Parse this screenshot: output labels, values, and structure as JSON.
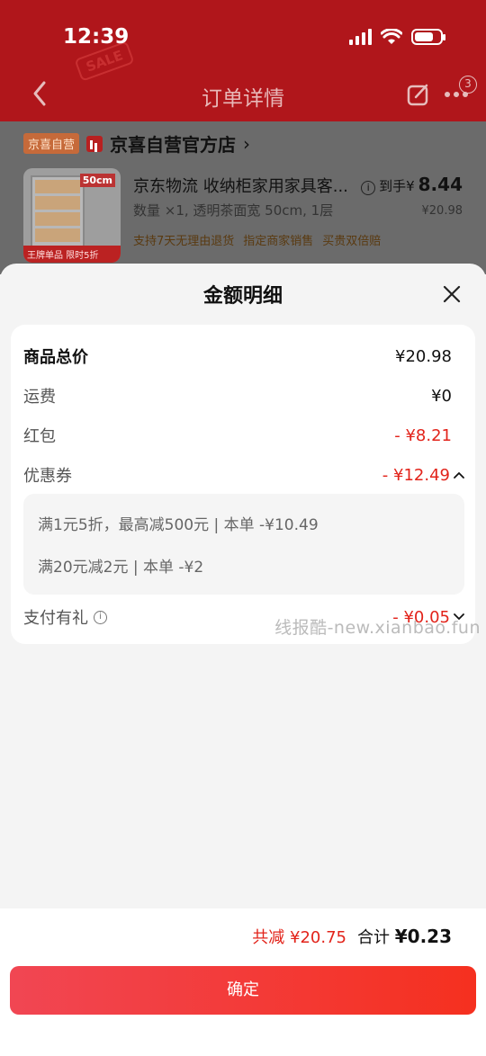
{
  "status_bar": {
    "time": "12:39"
  },
  "background_page": {
    "nav_title": "订单详情",
    "message_badge": "3",
    "sale_tag": "SALE",
    "shop": {
      "tag": "京喜自营",
      "name": "京喜自营官方店",
      "arrow": "›"
    },
    "product": {
      "title": "京东物流 收纳柜家用家具客...",
      "spec": "数量 ×1, 透明茶面宽 50cm, 1层",
      "services": [
        "支持7天无理由退货",
        "指定商家销售",
        "买贵双倍赔"
      ],
      "price_label": "到手¥",
      "price_value": "8.44",
      "original_price": "¥20.98",
      "image_price_tag": "50cm",
      "image_promo": "王牌单品 限时5折"
    }
  },
  "sheet": {
    "title": "金额明细",
    "rows": {
      "goods_total": {
        "label": "商品总价",
        "value": "¥20.98"
      },
      "shipping": {
        "label": "运费",
        "value": "¥0"
      },
      "red_packet": {
        "label": "红包",
        "value": "- ¥8.21"
      },
      "coupon": {
        "label": "优惠券",
        "value": "- ¥12.49"
      },
      "pay_gift": {
        "label": "支付有礼",
        "value": "- ¥0.05"
      }
    },
    "coupon_details": [
      "满1元5折，最高减500元 | 本单 -¥10.49",
      "满20元减2元 | 本单 -¥2"
    ],
    "watermark": "线报酷-new.xianbao.fun"
  },
  "footer": {
    "saved_text": "共减 ¥20.75",
    "total_label": "合计",
    "total_value": "¥0.23",
    "confirm_label": "确定"
  },
  "colors": {
    "accent_red": "#e2231a",
    "header_dim": "#b0161b",
    "button_gradient_start": "#f14653",
    "button_gradient_end": "#f5301f"
  }
}
